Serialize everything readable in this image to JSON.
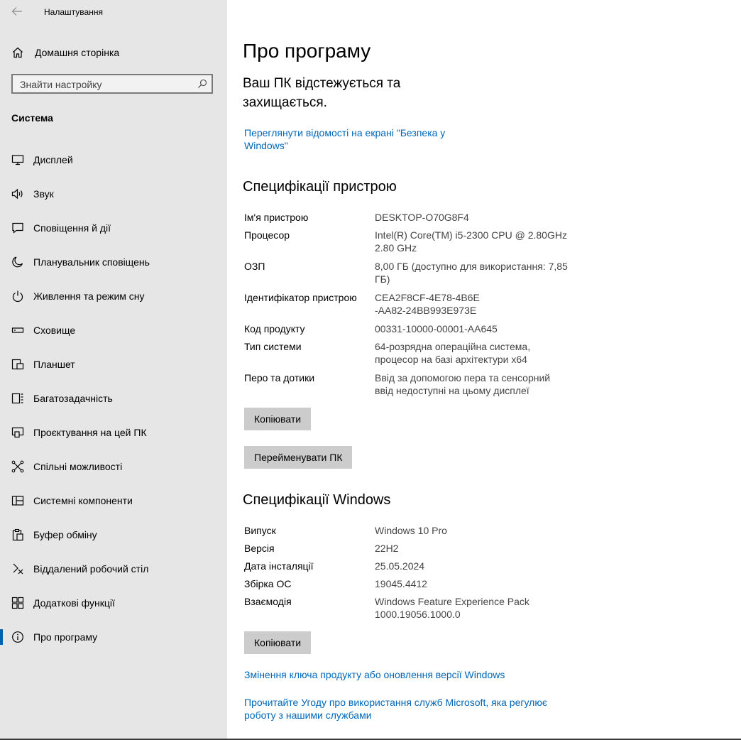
{
  "window": {
    "title": "Налаштування"
  },
  "sidebar": {
    "home_label": "Домашня сторінка",
    "search_placeholder": "Знайти настройку",
    "section_title": "Система",
    "items": [
      {
        "label": "Дисплей",
        "icon": "display-icon"
      },
      {
        "label": "Звук",
        "icon": "speaker-icon"
      },
      {
        "label": "Сповіщення й дії",
        "icon": "notifications-icon"
      },
      {
        "label": "Планувальник сповіщень",
        "icon": "moon-icon"
      },
      {
        "label": "Живлення та режим сну",
        "icon": "power-icon"
      },
      {
        "label": "Сховище",
        "icon": "storage-icon"
      },
      {
        "label": "Планшет",
        "icon": "tablet-icon"
      },
      {
        "label": "Багатозадачність",
        "icon": "multitasking-icon"
      },
      {
        "label": "Проєктування на цей ПК",
        "icon": "projecting-icon"
      },
      {
        "label": "Спільні можливості",
        "icon": "shared-experiences-icon"
      },
      {
        "label": "Системні компоненти",
        "icon": "system-components-icon"
      },
      {
        "label": "Буфер обміну",
        "icon": "clipboard-icon"
      },
      {
        "label": "Віддалений робочий стіл",
        "icon": "remote-desktop-icon"
      },
      {
        "label": "Додаткові функції",
        "icon": "optional-features-icon"
      },
      {
        "label": "Про програму",
        "icon": "info-icon",
        "active": true
      }
    ]
  },
  "main": {
    "title": "Про програму",
    "protected_text": "Ваш ПК відстежується та захищається.",
    "security_link": "Переглянути відомості на екрані \"Безпека у Windows\"",
    "device_specs": {
      "heading": "Специфікації пристрою",
      "rows": [
        {
          "key": "Ім'я пристрою",
          "value": "DESKTOP-O70G8F4"
        },
        {
          "key": "Процесор",
          "value": "Intel(R) Core(TM) i5-2300 CPU @ 2.80GHz 2.80 GHz"
        },
        {
          "key": "ОЗП",
          "value": "8,00 ГБ (доступно для використання: 7,85 ГБ)"
        },
        {
          "key": "Ідентифікатор пристрою",
          "value": "CEA2F8CF-4E78-4B6E-AA82-24BB993E973E"
        },
        {
          "key": "Код продукту",
          "value": "00331-10000-00001-AA645"
        },
        {
          "key": "Тип системи",
          "value": "64-розрядна операційна система, процесор на базі архітектури x64"
        },
        {
          "key": "Перо та дотики",
          "value": "Ввід за допомогою пера та сенсорний ввід недоступні на цьому дисплеї"
        }
      ],
      "copy_button": "Копіювати",
      "rename_button": "Перейменувати ПК"
    },
    "windows_specs": {
      "heading": "Специфікації Windows",
      "rows": [
        {
          "key": "Випуск",
          "value": "Windows 10 Pro"
        },
        {
          "key": "Версія",
          "value": "22H2"
        },
        {
          "key": "Дата інсталяції",
          "value": "25.05.2024"
        },
        {
          "key": "Збірка ОС",
          "value": "19045.4412"
        },
        {
          "key": "Взаємодія",
          "value": "Windows Feature Experience Pack 1000.19056.1000.0"
        }
      ],
      "copy_button": "Копіювати"
    },
    "links": {
      "product_key": "Змінення ключа продукту або оновлення версії Windows",
      "agreement": "Прочитайте Угоду про використання служб Microsoft, яка регулює роботу з нашими службами"
    }
  }
}
